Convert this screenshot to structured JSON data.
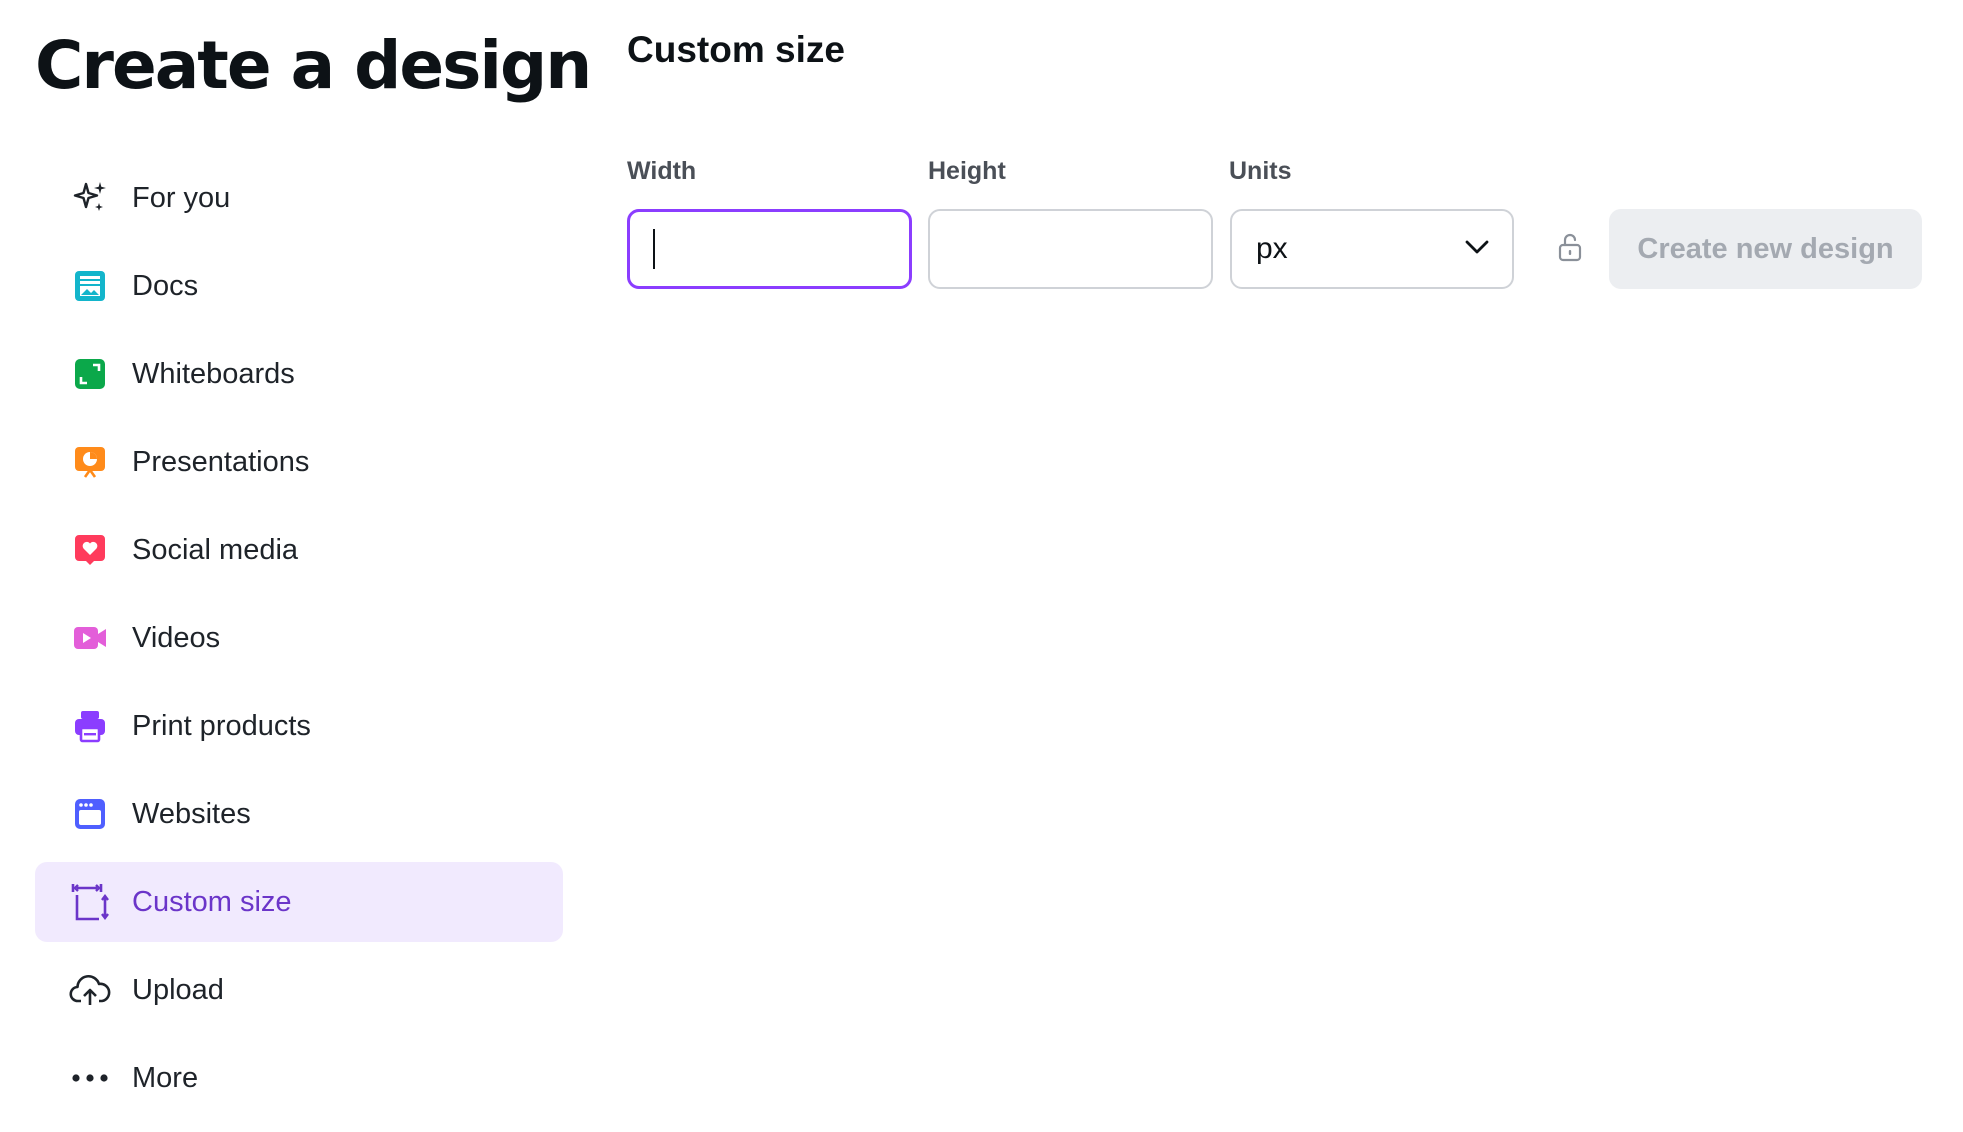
{
  "page": {
    "title": "Create a design"
  },
  "sidebar": {
    "items": [
      {
        "label": "For you",
        "icon": "sparkles-icon",
        "color": "#1e2329",
        "active": false
      },
      {
        "label": "Docs",
        "icon": "docs-icon",
        "color": "#13b5cb",
        "active": false
      },
      {
        "label": "Whiteboards",
        "icon": "whiteboard-icon",
        "color": "#0ba84a",
        "active": false
      },
      {
        "label": "Presentations",
        "icon": "presentation-icon",
        "color": "#ff8b1a",
        "active": false
      },
      {
        "label": "Social media",
        "icon": "heart-icon",
        "color": "#ff3b5c",
        "active": false
      },
      {
        "label": "Videos",
        "icon": "video-icon",
        "color": "#e35ed9",
        "active": false
      },
      {
        "label": "Print products",
        "icon": "printer-icon",
        "color": "#8b3dff",
        "active": false
      },
      {
        "label": "Websites",
        "icon": "browser-icon",
        "color": "#4f5fff",
        "active": false
      },
      {
        "label": "Custom size",
        "icon": "custom-size-icon",
        "color": "#6b35c9",
        "active": true
      },
      {
        "label": "Upload",
        "icon": "cloud-upload-icon",
        "color": "#1e2329",
        "active": false
      },
      {
        "label": "More",
        "icon": "more-dots-icon",
        "color": "#1e2329",
        "active": false
      }
    ]
  },
  "custom_size": {
    "title": "Custom size",
    "width_label": "Width",
    "width_value": "",
    "height_label": "Height",
    "height_value": "",
    "units_label": "Units",
    "units_value": "px",
    "create_button_label": "Create new design"
  },
  "colors": {
    "accent": "#8b3dff",
    "active_bg": "#f1eafe",
    "active_text": "#6b35c9",
    "button_disabled_bg": "#eceef1",
    "button_disabled_text": "#a4a9b1"
  }
}
